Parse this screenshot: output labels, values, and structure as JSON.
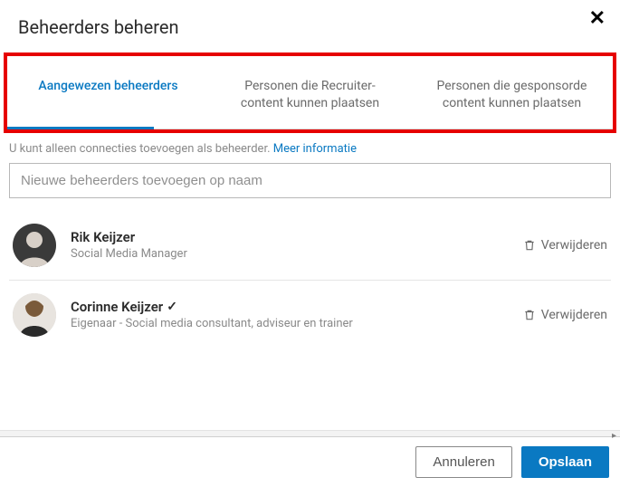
{
  "header": {
    "title": "Beheerders beheren",
    "close_symbol": "✕"
  },
  "tabs": [
    {
      "label": "Aangewezen beheerders",
      "active": true
    },
    {
      "label_line1": "Personen die Recruiter-",
      "label_line2": "content kunnen plaatsen",
      "active": false
    },
    {
      "label_line1": "Personen die gesponsorde",
      "label_line2": "content kunnen plaatsen",
      "active": false
    }
  ],
  "helper": {
    "text": "U kunt alleen connecties toevoegen als beheerder. ",
    "link_text": "Meer informatie"
  },
  "search": {
    "placeholder": "Nieuwe beheerders toevoegen op naam"
  },
  "remove_label": "Verwijderen",
  "admins": [
    {
      "name": "Rik Keijzer",
      "title": "Social Media Manager",
      "verified": false
    },
    {
      "name": "Corinne Keijzer",
      "title": "Eigenaar - Social media consultant, adviseur en trainer",
      "verified": true
    }
  ],
  "footer": {
    "cancel": "Annuleren",
    "save": "Opslaan"
  }
}
